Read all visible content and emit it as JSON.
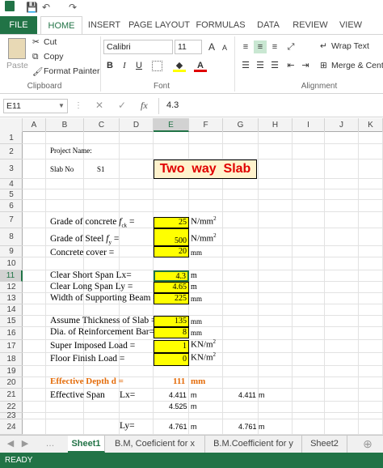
{
  "qat": {
    "save": "💾",
    "undo": "↶",
    "redo": "↷"
  },
  "tabs": [
    "FILE",
    "HOME",
    "INSERT",
    "PAGE LAYOUT",
    "FORMULAS",
    "DATA",
    "REVIEW",
    "VIEW"
  ],
  "ribbon": {
    "paste": "Paste",
    "cut": "Cut",
    "copy": "Copy",
    "format_painter": "Format Painter",
    "clipboard": "Clipboard",
    "font_name": "Calibri",
    "font_size": "11",
    "font": "Font",
    "bold": "B",
    "italic": "I",
    "underline": "U",
    "grow": "A",
    "shrink": "A",
    "wrap_text": "Wrap Text",
    "merge": "Merge & Cente",
    "alignment": "Alignment"
  },
  "formula_bar": {
    "name_box": "E11",
    "fx": "fx",
    "value": "4.3"
  },
  "columns": [
    "A",
    "B",
    "C",
    "D",
    "E",
    "F",
    "G",
    "H",
    "I",
    "J",
    "K"
  ],
  "rows": [
    "1",
    "2",
    "3",
    "4",
    "5",
    "6",
    "7",
    "8",
    "9",
    "10",
    "11",
    "12",
    "13",
    "14",
    "15",
    "16",
    "17",
    "18",
    "19",
    "20",
    "21",
    "22",
    "23",
    "24"
  ],
  "sheet": {
    "project_name": "Project Name:",
    "slab_no": "Slab No",
    "slab_id": "S1",
    "title": "Two  way  Slab",
    "grade_concrete": "Grade of concrete",
    "fck": "f",
    "fck_sub": "ck",
    "eq": " =",
    "grade_steel": "Grade of Steel",
    "fy": "f",
    "fy_sub": "y",
    "eq2": " =",
    "cover": "Concrete cover =",
    "lx_label": "Clear Short Span  Lx=",
    "ly_label": "Clear Long Span  Ly =",
    "beam_label": "Width of Supporting Beam =",
    "thick_label": "Assume Thickness of Slab =",
    "dia_label": "Dia. of Reinforcement Bar=",
    "sil_label": "Super Imposed Load =",
    "ffl_label": "Floor Finish Load =",
    "eff_depth_label": "Effective Depth  d =",
    "eff_depth_val": "111",
    "eff_depth_unit": "mm",
    "eff_span": "Effective Span",
    "lx_eq": "Lx=",
    "ly_eq": "Ly=",
    "v7": "25",
    "u7": "N/mm",
    "u7s": "2",
    "v8": "500",
    "u8": "N/mm",
    "u8s": "2",
    "v9": "20",
    "u9": "mm",
    "v11": "4.3",
    "u11": "m",
    "v12": "4.65",
    "u12": "m",
    "v13": "225",
    "u13": "mm",
    "v15": "135",
    "u15": "mm",
    "v16": "8",
    "u16": "mm",
    "v17": "1",
    "u17": "KN/m",
    "u17s": "2",
    "v18": "0",
    "u18": "KN/m",
    "u18s": "2",
    "e21": "4.411",
    "f21": "m",
    "g21": "4.411",
    "h21": "m",
    "e22": "4.525",
    "f22": "m",
    "e24": "4.761",
    "f24": "m",
    "g24": "4.761",
    "h24": "m"
  },
  "sheet_tabs": [
    "Sheet1",
    "B.M, Coeficient for x",
    "B.M.Coefficient for y",
    "Sheet2"
  ],
  "status": "READY"
}
